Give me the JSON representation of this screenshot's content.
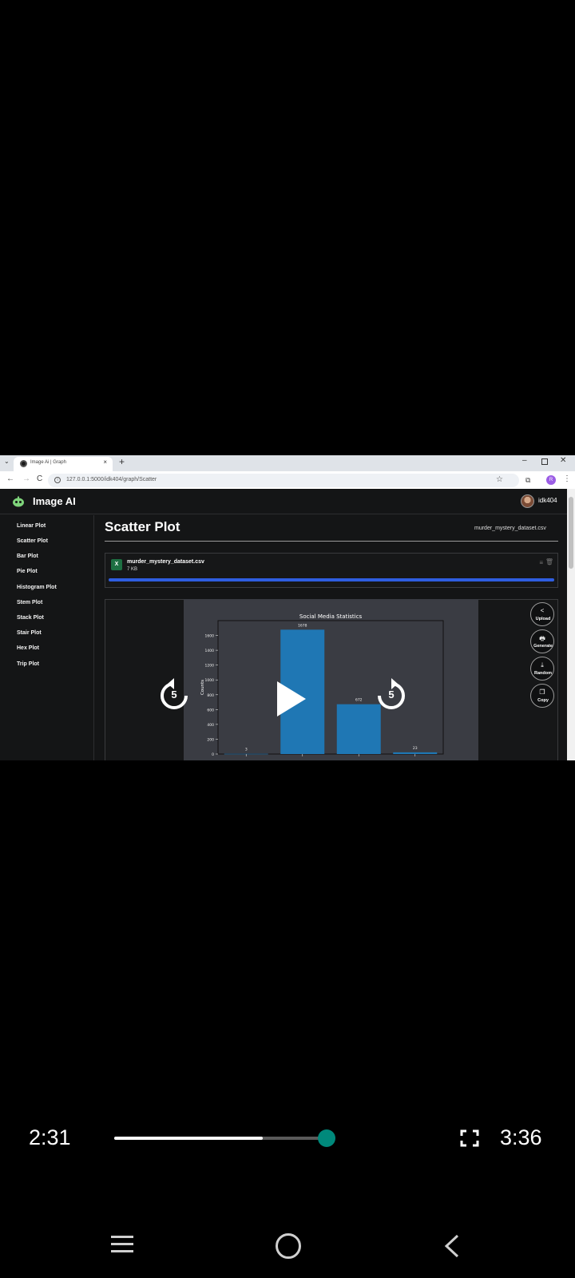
{
  "browser": {
    "tab_title": "Image Ai | Graph",
    "url": "127.0.0.1:5000/idk404/graph/Scatter",
    "profile_initial": "R",
    "tab_close": "×",
    "new_tab": "+",
    "win_min": "–",
    "win_close": "✕",
    "back": "←",
    "forward": "→",
    "reload": "C",
    "menu": "⋮",
    "star": "☆",
    "tab_menu": "⌄"
  },
  "app": {
    "name": "Image AI",
    "user": "idk404",
    "page_title": "Scatter Plot",
    "dataset": "murder_mystery_dataset.csv"
  },
  "sidebar": {
    "items": [
      {
        "label": "Linear Plot"
      },
      {
        "label": "Scatter Plot"
      },
      {
        "label": "Bar Plot"
      },
      {
        "label": "Pie Plot"
      },
      {
        "label": "Histogram Plot"
      },
      {
        "label": "Stem Plot"
      },
      {
        "label": "Stack Plot"
      },
      {
        "label": "Stair Plot"
      },
      {
        "label": "Hex Plot"
      },
      {
        "label": "Trip Plot"
      }
    ]
  },
  "file": {
    "name": "murder_mystery_dataset.csv",
    "size": "7 KB",
    "icon_letter": "X",
    "upload_progress": 1.0,
    "menu_glyph": "≡",
    "delete_glyph": "🗑"
  },
  "actions": [
    {
      "label": "Upload",
      "icon": "share-icon",
      "glyph": "<"
    },
    {
      "label": "Generate",
      "icon": "printer-icon",
      "glyph": "🖶"
    },
    {
      "label": "Random",
      "icon": "download-icon",
      "glyph": "⤓"
    },
    {
      "label": "Copy",
      "icon": "copy-icon",
      "glyph": "❐"
    }
  ],
  "chart_data": {
    "type": "bar",
    "title": "Social Media Statistics",
    "ylabel": "Counts",
    "ylim": [
      0,
      1800
    ],
    "yticks": [
      0,
      200,
      400,
      600,
      800,
      1000,
      1200,
      1400,
      1600
    ],
    "values": [
      3,
      1678,
      672,
      23
    ],
    "data_labels": [
      "3",
      "1678",
      "672",
      "23"
    ],
    "bar_color": "#1f77b4"
  },
  "player": {
    "current_time": "2:31",
    "total_time": "3:36",
    "progress": 0.699,
    "skip_back_seconds": "5",
    "skip_forward_seconds": "5",
    "accent": "#00897b"
  }
}
